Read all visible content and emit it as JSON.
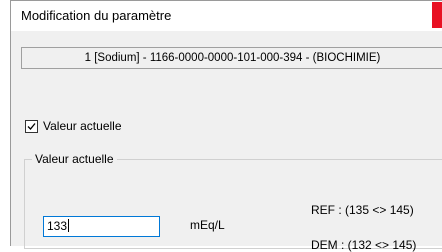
{
  "window": {
    "title": "Modification du paramètre"
  },
  "header": {
    "parameter": "1 [Sodium] - 1166-0000-0000-101-000-394 - (BIOCHIMIE)"
  },
  "current_value_checkbox": {
    "label": "Valeur actuelle",
    "checked": true
  },
  "group": {
    "legend": "Valeur actuelle",
    "value": "133",
    "unit": "mEq/L",
    "ref": "REF : (135 <> 145)",
    "dem": "DEM : (132 <> 145)"
  },
  "colors": {
    "close_button": "#e81123",
    "input_focus_border": "#0078d7"
  }
}
